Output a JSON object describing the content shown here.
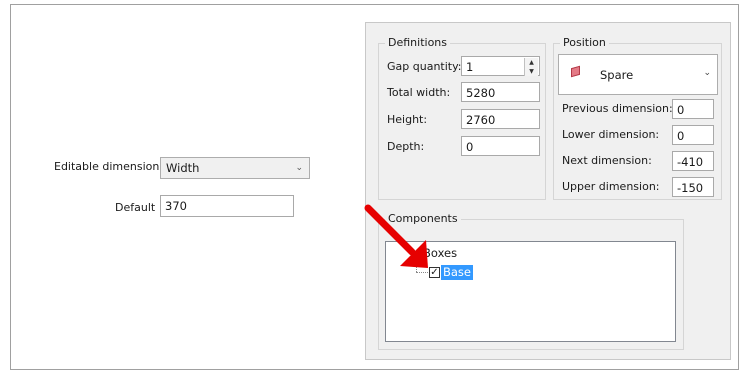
{
  "left_form": {
    "editable_dimension_label": "Editable dimension",
    "editable_dimension_value": "Width",
    "default_label": "Default",
    "default_value": "370"
  },
  "definitions": {
    "title": "Definitions",
    "gap_quantity_label": "Gap quantity:",
    "gap_quantity_value": "1",
    "total_width_label": "Total width:",
    "total_width_value": "5280",
    "height_label": "Height:",
    "height_value": "2760",
    "depth_label": "Depth:",
    "depth_value": "0"
  },
  "position": {
    "title": "Position",
    "selected": "Spare",
    "previous_dimension_label": "Previous dimension:",
    "previous_dimension_value": "0",
    "lower_dimension_label": "Lower dimension:",
    "lower_dimension_value": "0",
    "next_dimension_label": "Next dimension:",
    "next_dimension_value": "-410",
    "upper_dimension_label": "Upper dimension:",
    "upper_dimension_value": "-150"
  },
  "components": {
    "title": "Components",
    "tree": {
      "root_label": "Boxes",
      "child_label": "Base",
      "child_checked": true
    }
  },
  "colors": {
    "selection": "#3399ff",
    "annotation_arrow": "#e60000",
    "panel_bg": "#f0f0f0"
  }
}
